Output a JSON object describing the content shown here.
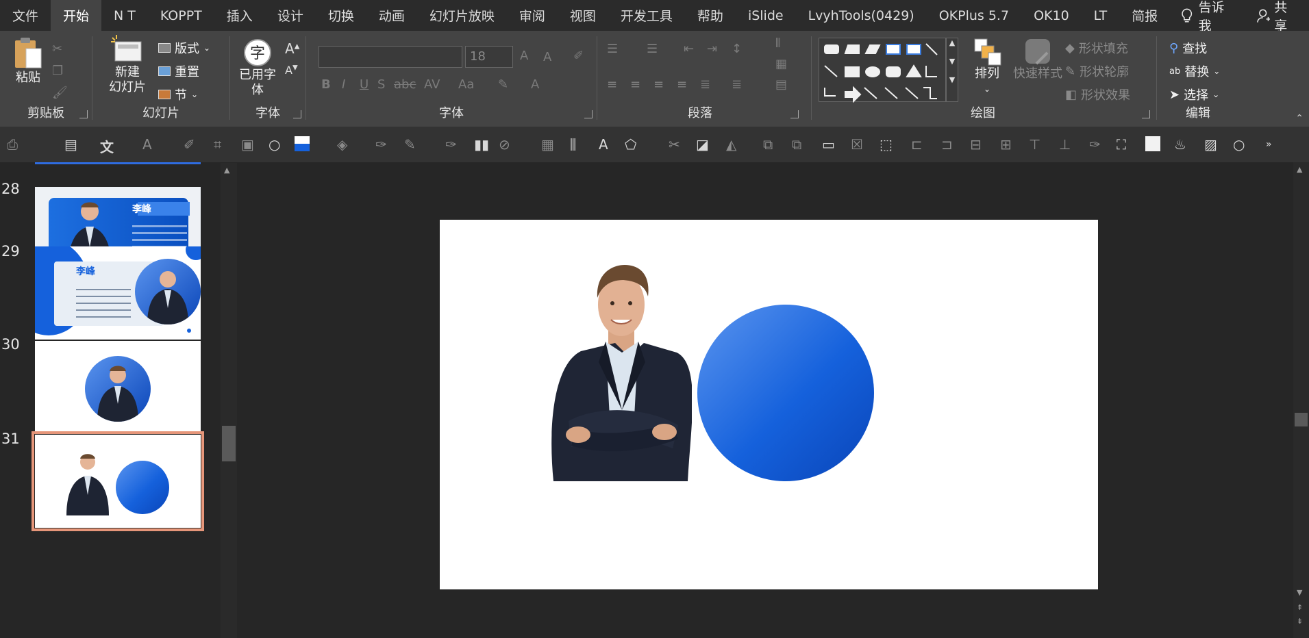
{
  "menu": {
    "tabs": [
      "文件",
      "开始",
      "N T",
      "KOPPT",
      "插入",
      "设计",
      "切换",
      "动画",
      "幻灯片放映",
      "审阅",
      "视图",
      "开发工具",
      "帮助",
      "iSlide",
      "LvyhTools(0429)",
      "OKPlus 5.7",
      "OK10",
      "LT",
      "简报"
    ],
    "active_index": 1,
    "tellme": "告诉我",
    "share": "共享"
  },
  "ribbon": {
    "clipboard": {
      "paste": "粘贴",
      "label": "剪贴板"
    },
    "slides": {
      "new_slide_line1": "新建",
      "new_slide_line2": "幻灯片",
      "layout": "版式",
      "reset": "重置",
      "section": "节",
      "label": "幻灯片"
    },
    "font_small": {
      "used_font_line1": "已用字",
      "used_font_line2": "体",
      "label": "字体"
    },
    "font": {
      "font_size": "18",
      "label": "字体"
    },
    "paragraph": {
      "label": "段落"
    },
    "drawing": {
      "arrange": "排列",
      "quick_styles": "快速样式",
      "shape_fill": "形状填充",
      "shape_outline": "形状轮廓",
      "shape_effects": "形状效果",
      "label": "绘图"
    },
    "editing": {
      "find": "查找",
      "replace": "替换",
      "select": "选择",
      "label": "编辑"
    }
  },
  "thumbnails": [
    {
      "number": "28",
      "title": "李峰"
    },
    {
      "number": "29",
      "title": "李峰"
    },
    {
      "number": "30"
    },
    {
      "number": "31",
      "selected": true
    }
  ],
  "colors": {
    "accent_blue": "#1561dc",
    "selection": "#e6967a",
    "ribbon_bg": "#444444"
  }
}
